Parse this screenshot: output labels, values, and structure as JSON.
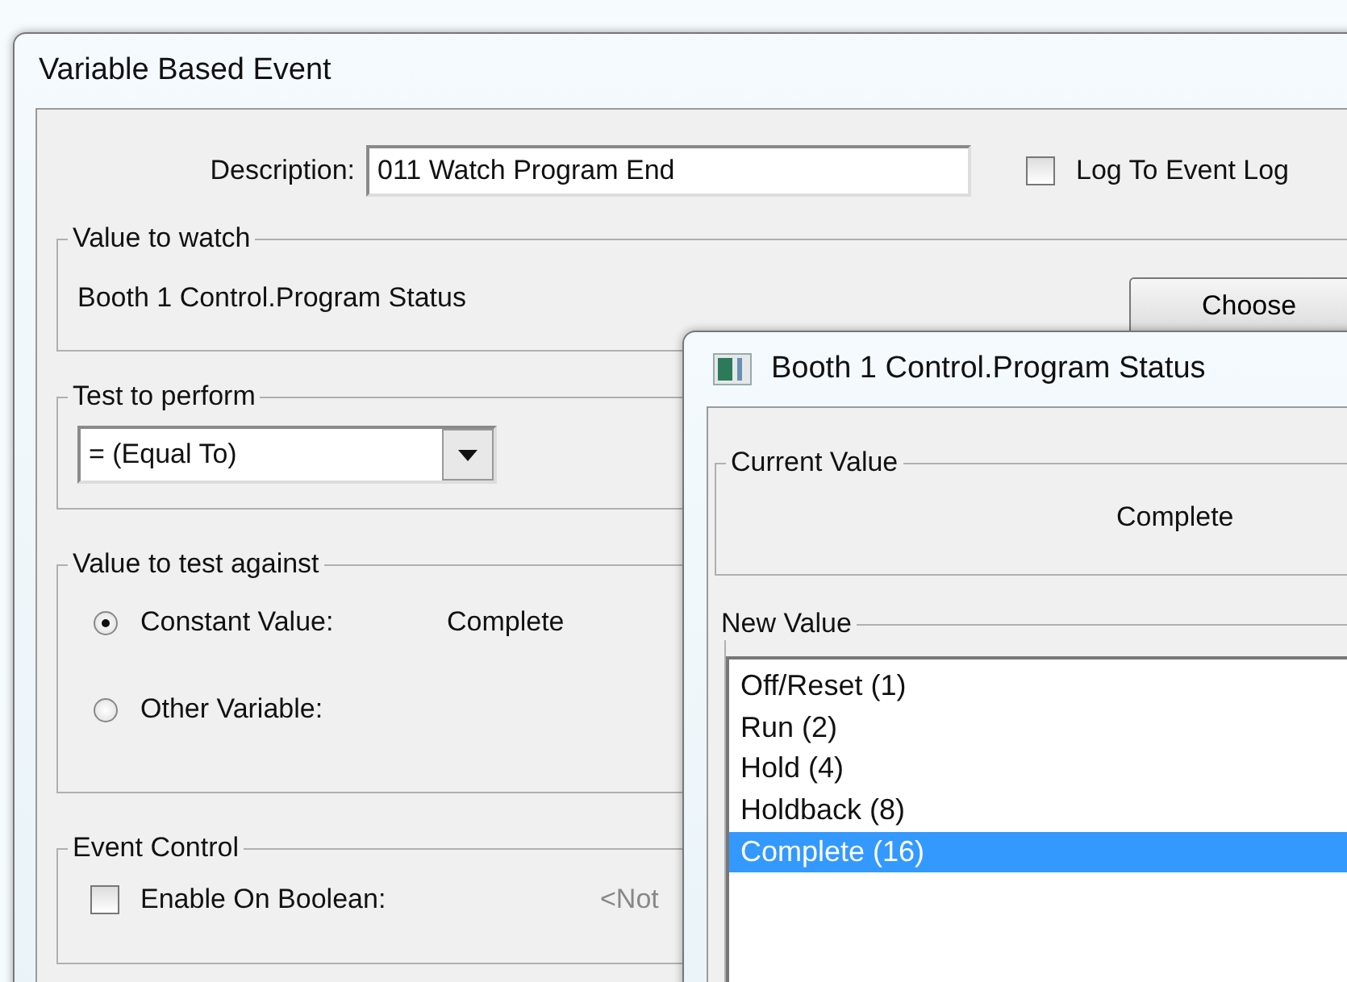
{
  "main_dialog": {
    "title": "Variable Based Event",
    "description": {
      "label": "Description:",
      "value": "011 Watch Program End"
    },
    "log_to_event_log": {
      "label": "Log To Event Log",
      "checked": false
    },
    "value_to_watch": {
      "title": "Value to watch",
      "variable": "Booth 1 Control.Program Status",
      "button": "Choose"
    },
    "test_to_perform": {
      "title": "Test to perform",
      "value": "= (Equal To)"
    },
    "value_to_test_against": {
      "title": "Value to test against",
      "options": [
        {
          "label": "Constant Value:",
          "selected": true,
          "value": "Complete"
        },
        {
          "label": "Other Variable:",
          "selected": false
        }
      ]
    },
    "event_control": {
      "title": "Event Control",
      "enable_on_boolean": {
        "label": "Enable On Boolean:",
        "checked": false,
        "value": "<Not"
      }
    }
  },
  "value_dialog": {
    "title": "Booth 1 Control.Program Status",
    "current_value": {
      "title": "Current Value",
      "value": "Complete"
    },
    "new_value": {
      "title": "New Value",
      "items": [
        {
          "label": "Off/Reset (1)",
          "selected": false
        },
        {
          "label": "Run (2)",
          "selected": false
        },
        {
          "label": "Hold (4)",
          "selected": false
        },
        {
          "label": "Holdback (8)",
          "selected": false
        },
        {
          "label": "Complete (16)",
          "selected": true
        }
      ]
    }
  }
}
